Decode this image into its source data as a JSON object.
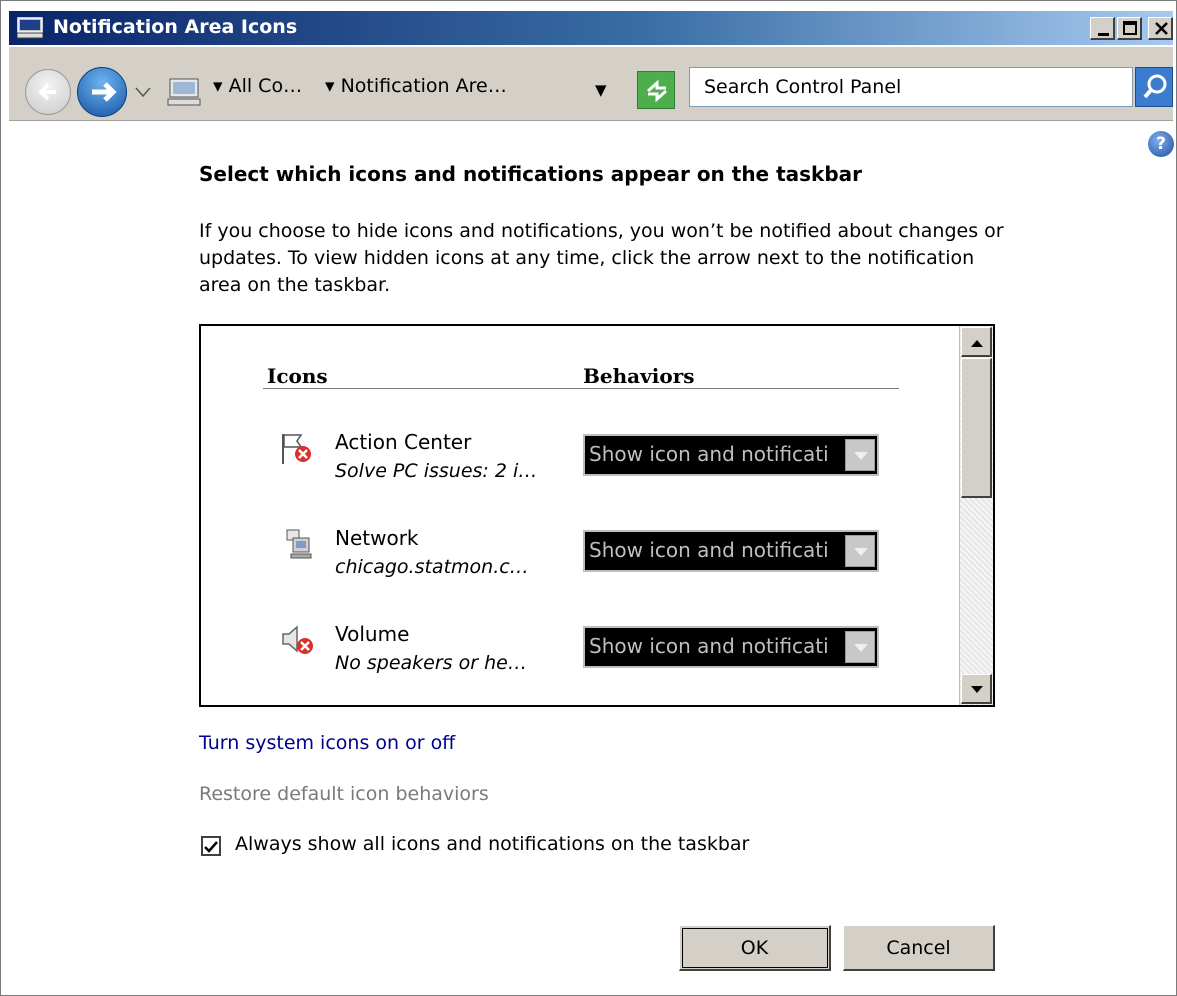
{
  "window": {
    "title": "Notification Area Icons",
    "title_icon": "control-panel-icon"
  },
  "address_bar": {
    "segment_1": "All Co…",
    "segment_2": "Notification Are…",
    "search_placeholder": "Search Control Panel"
  },
  "content": {
    "heading": "Select which icons and notifications appear on the taskbar",
    "description": "If you choose to hide icons and notifications, you won’t be notified about changes or updates. To view hidden icons at any time, click the arrow next to the notification area on the taskbar."
  },
  "list": {
    "col_icons": "Icons",
    "col_behaviors": "Behaviors",
    "rows": [
      {
        "name": "Action Center",
        "detail": "Solve PC issues: 2 i…",
        "behavior": "Show icon and notificati",
        "icon": "action-center-flag-icon"
      },
      {
        "name": "Network",
        "detail": "chicago.statmon.c…",
        "behavior": "Show icon and notificati",
        "icon": "network-icon"
      },
      {
        "name": "Volume",
        "detail": "No speakers or he…",
        "behavior": "Show icon and notificati",
        "icon": "speaker-muted-icon"
      }
    ]
  },
  "links": {
    "system_icons": "Turn system icons on or off",
    "restore_defaults": "Restore default icon behaviors"
  },
  "checkbox": {
    "label": "Always show all icons and notifications on the taskbar",
    "checked": true
  },
  "buttons": {
    "ok": "OK",
    "cancel": "Cancel"
  }
}
